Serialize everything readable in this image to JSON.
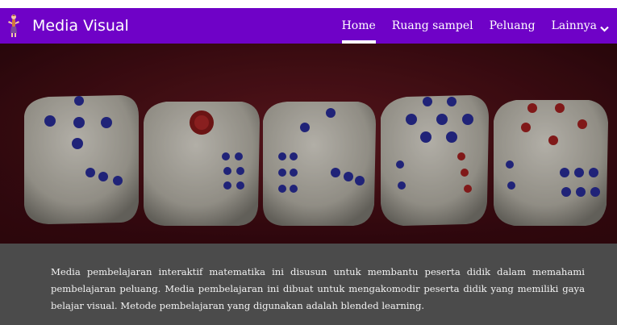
{
  "navbar": {
    "brand": "Media Visual",
    "brand_icon": "figure-logo-icon",
    "bg_color": "#6f02c7",
    "items": [
      {
        "label": "Home",
        "active": true
      },
      {
        "label": "Ruang sampel",
        "active": false
      },
      {
        "label": "Peluang",
        "active": false
      },
      {
        "label": "Lainnya",
        "active": false,
        "dropdown": true,
        "icon": "chevron-down-icon"
      }
    ]
  },
  "hero": {
    "image": "dice-banner"
  },
  "intro": {
    "text": "Media pembelajaran interaktif matematika ini disusun untuk membantu peserta didik dalam memahami pembelajaran peluang. Media pembelajaran ini dibuat untuk mengakomodir peserta didik yang memiliki gaya belajar visual. Metode pembelajaran yang digunakan adalah blended learning."
  }
}
